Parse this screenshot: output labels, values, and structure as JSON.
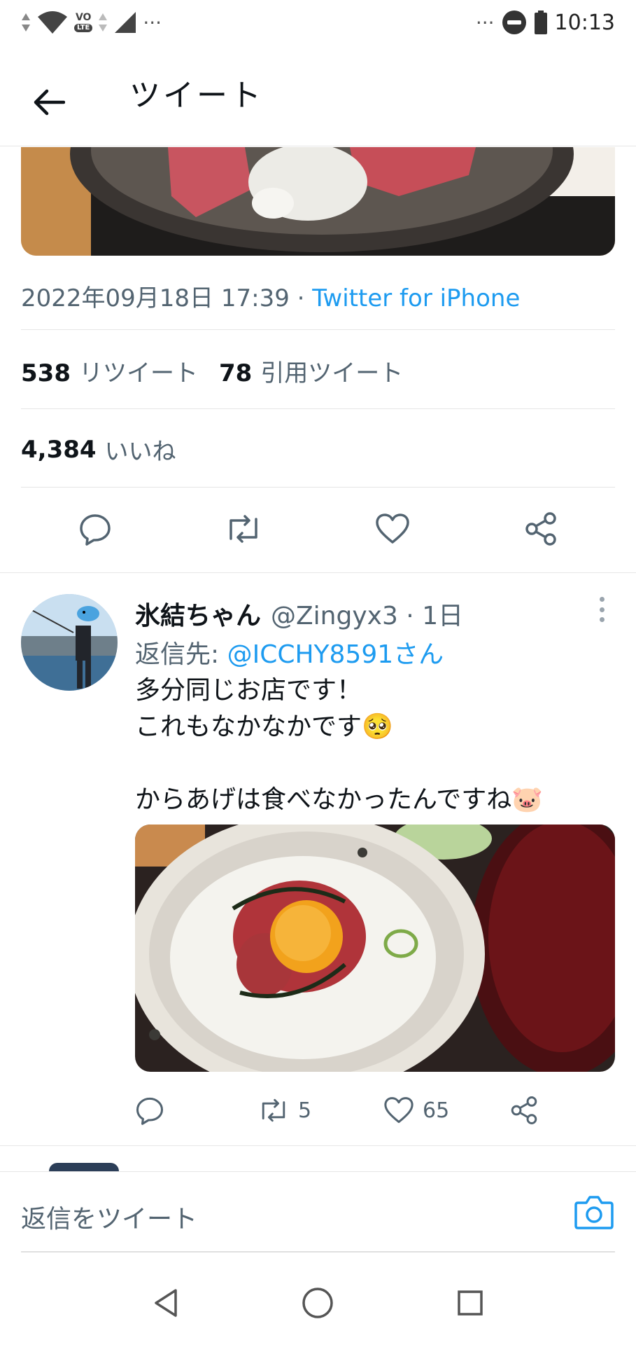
{
  "status_bar": {
    "left_overflow": "···",
    "right_overflow": "···",
    "time": "10:13",
    "network_badge_top": "VO",
    "network_badge_bottom": "LTE"
  },
  "header": {
    "title": "ツイート",
    "back_icon": "arrow-left-icon"
  },
  "tweet": {
    "timestamp": "2022年09月18日 17:39 · ",
    "source": "Twitter for iPhone",
    "retweets_count": "538",
    "retweets_label": "リツイート",
    "quotes_count": "78",
    "quotes_label": "引用ツイート",
    "likes_count": "4,384",
    "likes_label": "いいね"
  },
  "reply": {
    "name": "氷結ちゃん",
    "handle": "@Zingyx3 · 1日",
    "reply_to_label": "返信先: ",
    "reply_to_mention": "@ICCHY8591さん",
    "text": "多分同じお店です！\nこれもなかなかです🥺\n\nからあげは食べなかったんですね🐷",
    "retweets": "5",
    "likes": "65"
  },
  "composer": {
    "placeholder": "返信をツイート"
  },
  "colors": {
    "accent": "#1d9bf0",
    "secondary_text": "#536471",
    "divider": "#e6e6e6"
  }
}
